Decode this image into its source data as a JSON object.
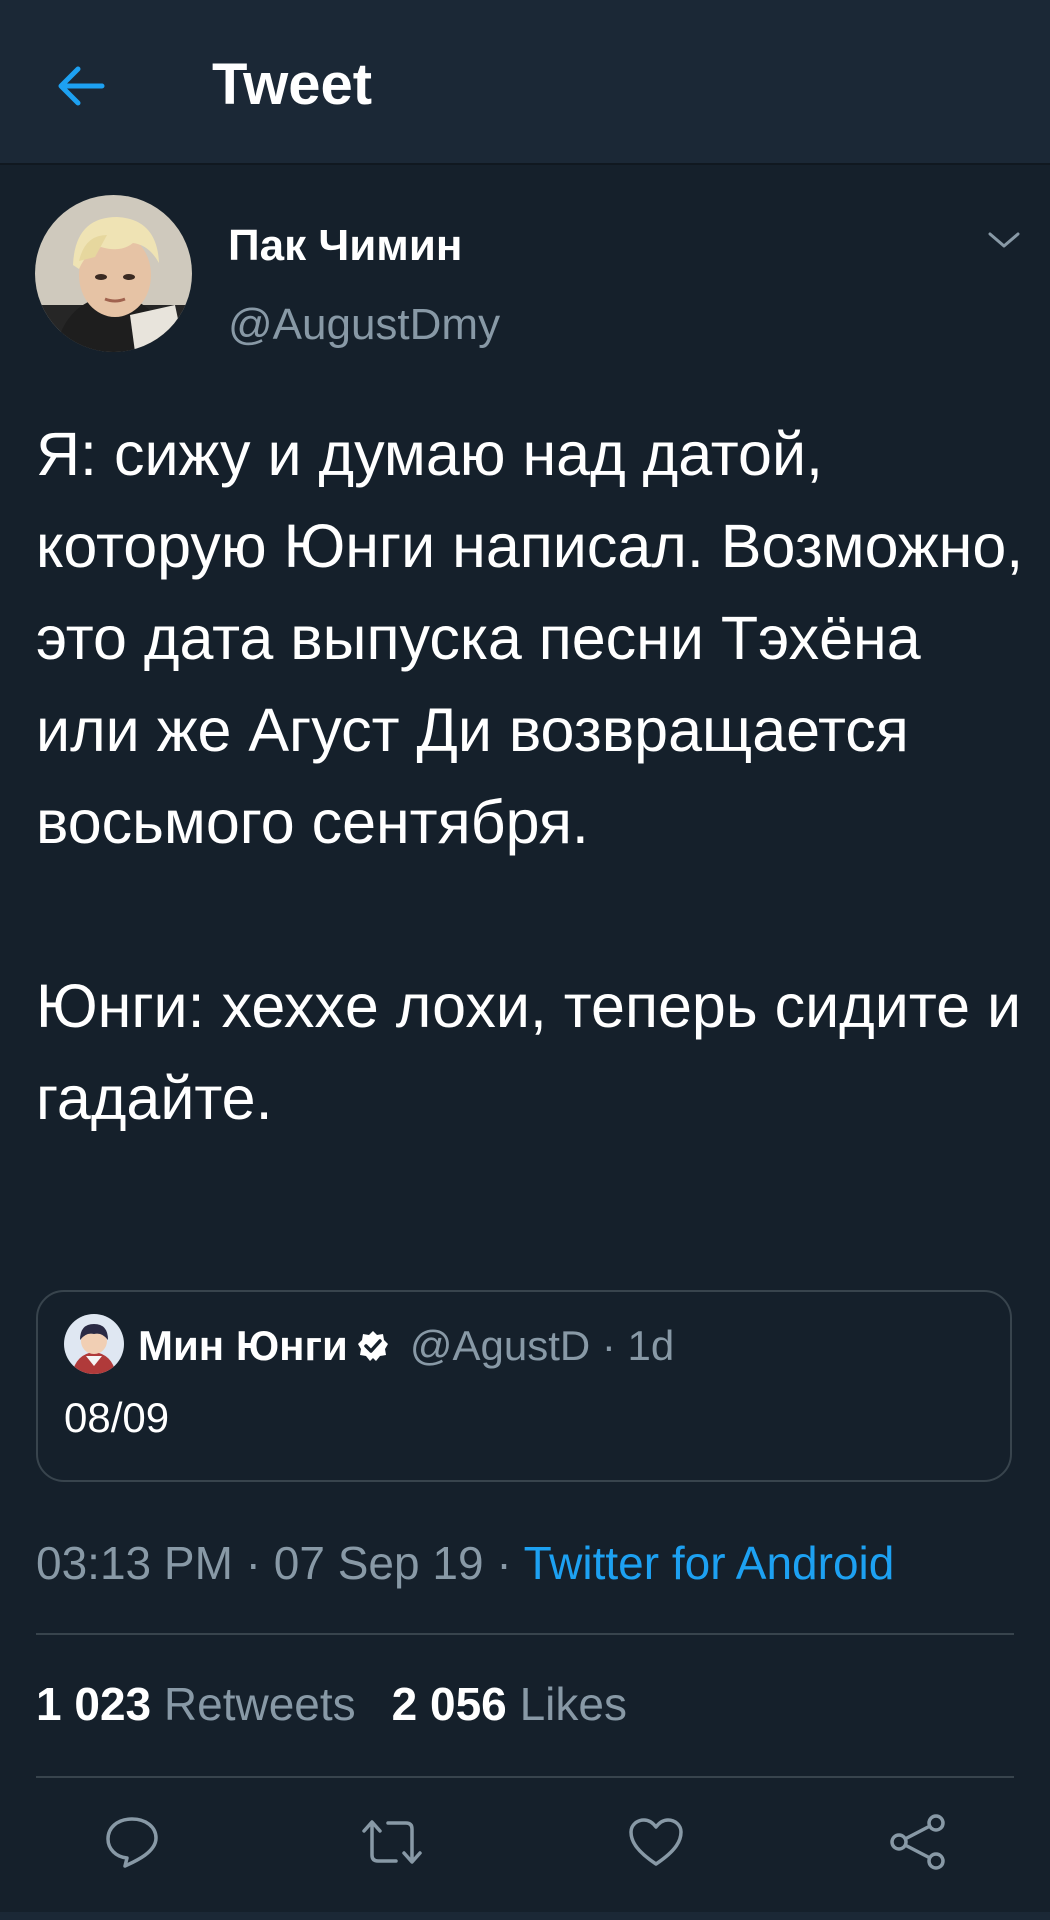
{
  "header": {
    "back_icon": "arrow-left-icon",
    "title": "Tweet"
  },
  "author": {
    "name": "Пак Чимин",
    "handle": "@AugustDmy",
    "menu_icon": "chevron-down-icon"
  },
  "tweet": {
    "text": "Я: сижу и думаю над датой, которую Юнги написал. Возможно, это дата выпуска песни Тэхёна или же Агуст Ди возвращается восьмого сентября.\n\nЮнги: хехxe лохи, теперь сидите и гадайте."
  },
  "quoted_tweet": {
    "name": "Мин Юнги",
    "verified_icon": "verified-badge-icon",
    "handle": "@AgustD",
    "separator": " · ",
    "time": "1d",
    "text": "08/09"
  },
  "meta": {
    "time": "03:13 PM",
    "separator": " · ",
    "date": "07 Sep 19",
    "source": "Twitter for Android"
  },
  "stats": {
    "retweets_count": "1 023",
    "retweets_label": "Retweets",
    "likes_count": "2 056",
    "likes_label": "Likes"
  },
  "actions": [
    "reply-icon",
    "retweet-icon",
    "like-icon",
    "share-icon"
  ],
  "colors": {
    "background": "#15202b",
    "header": "#1b2836",
    "accent": "#1da1f2",
    "secondary_text": "#8899a6",
    "border": "#38444d"
  }
}
